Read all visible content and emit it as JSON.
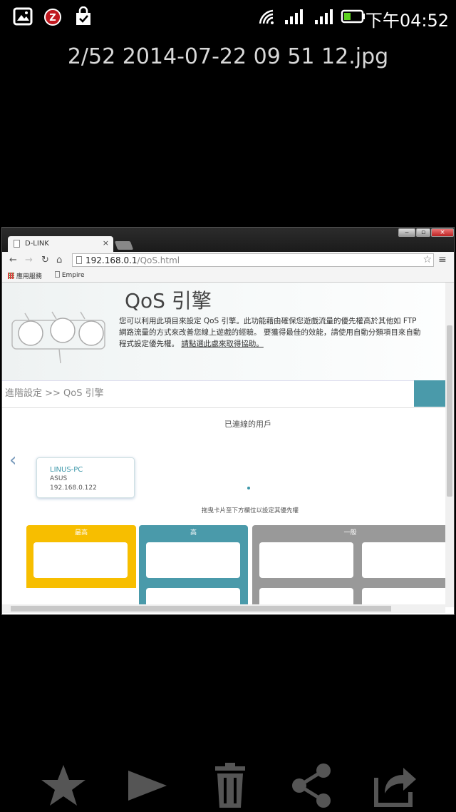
{
  "status_bar": {
    "time": "下午04:52"
  },
  "viewer": {
    "title": "2/52 2014-07-22 09 51 12.jpg"
  },
  "browser": {
    "tab_title": "D-LINK",
    "tab_close": "×",
    "window_buttons": [
      "‒",
      "▫",
      "×"
    ],
    "url_host": "192.168.0.1",
    "url_path": "/QoS.html",
    "bookmarks": [
      {
        "label": "應用服務"
      },
      {
        "label": "Empire"
      }
    ]
  },
  "page": {
    "title": "QoS 引擎",
    "description_lines": [
      "您可以利用此項目來設定 QoS 引擎。此功能藉由確保您遊戲流量的優先權高於其他如 FTP",
      "網路流量的方式來改善您線上遊戲的經驗。 要獲得最佳的效能，請使用自動分類項目來自動",
      "程式設定優先權。"
    ],
    "help_link": "請點選此處來取得協助。",
    "breadcrumb": "進階設定 >> QoS 引擎",
    "connected_users_label": "已連線的用戶",
    "device": {
      "name": "LINUS-PC",
      "vendor": "ASUS",
      "ip": "192.168.0.122"
    },
    "drag_hint": "拖曳卡片至下方欄位以設定其優先權",
    "priorities": [
      {
        "label": "最高",
        "color": "#f7be00"
      },
      {
        "label": "高",
        "color": "#4a9aaa"
      },
      {
        "label": "一般",
        "color": "#999999"
      }
    ]
  },
  "colors": {
    "accent": "#3a96a8"
  }
}
